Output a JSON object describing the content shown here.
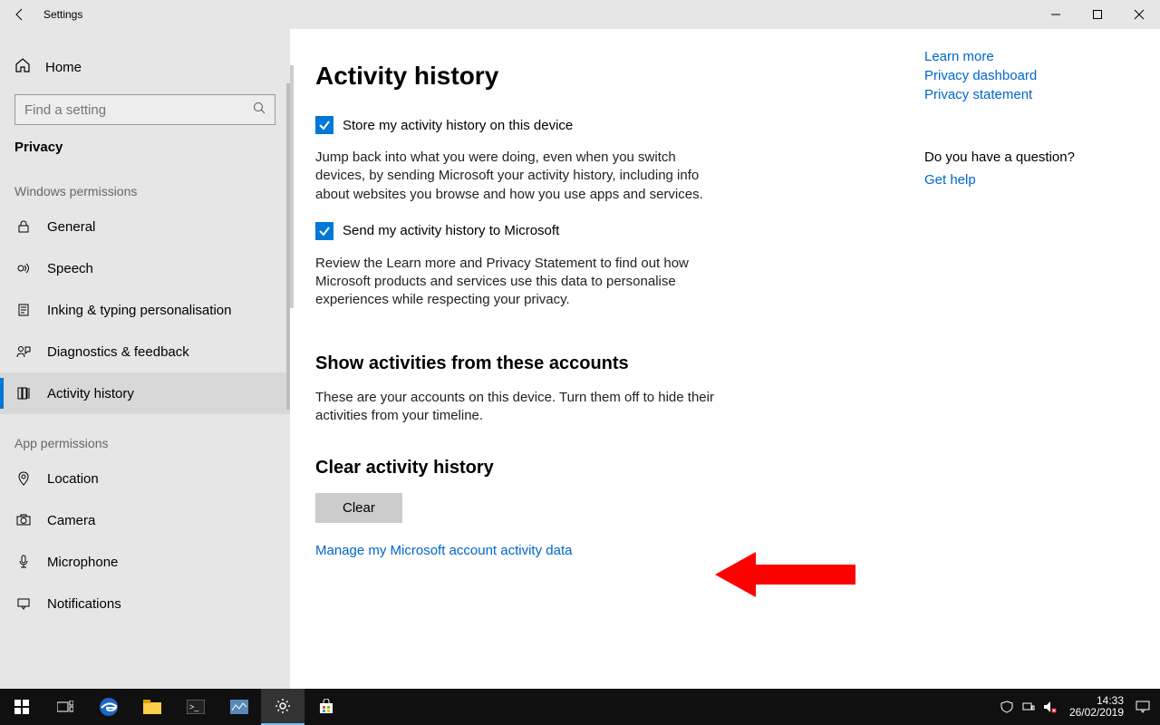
{
  "window": {
    "title": "Settings"
  },
  "sidebar": {
    "home": "Home",
    "search_placeholder": "Find a setting",
    "category": "Privacy",
    "group1": "Windows permissions",
    "items1": [
      "General",
      "Speech",
      "Inking & typing personalisation",
      "Diagnostics & feedback",
      "Activity history"
    ],
    "group2": "App permissions",
    "items2": [
      "Location",
      "Camera",
      "Microphone",
      "Notifications"
    ]
  },
  "content": {
    "title": "Activity history",
    "check1": "Store my activity history on this device",
    "para1": "Jump back into what you were doing, even when you switch devices, by sending Microsoft your activity history, including info about websites you browse and how you use apps and services.",
    "check2": "Send my activity history to Microsoft",
    "para2": "Review the Learn more and Privacy Statement to find out how Microsoft products and services use this data to personalise experiences while respecting your privacy.",
    "accounts_heading": "Show activities from these accounts",
    "accounts_para": "These are your accounts on this device. Turn them off to hide their activities from your timeline.",
    "clear_heading": "Clear activity history",
    "clear_button": "Clear",
    "manage_link": "Manage my Microsoft account activity data"
  },
  "right": {
    "links_top": [
      "Learn more",
      "Privacy dashboard",
      "Privacy statement"
    ],
    "question": "Do you have a question?",
    "get_help": "Get help"
  },
  "taskbar": {
    "time": "14:33",
    "date": "26/02/2019"
  }
}
